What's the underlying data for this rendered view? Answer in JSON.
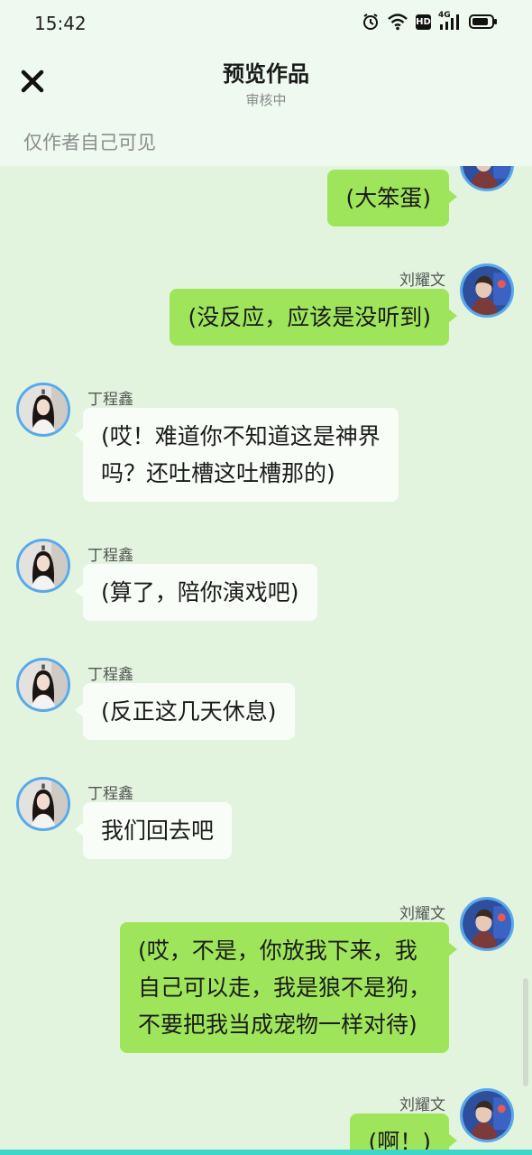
{
  "status_bar": {
    "time": "15:42",
    "network_label": "4G",
    "hd_label": "HD",
    "icons": [
      "alarm-icon",
      "wifi-icon",
      "hd-icon",
      "signal-icon",
      "battery-icon"
    ]
  },
  "header": {
    "title": "预览作品",
    "subtitle": "审核中",
    "visibility_note": "仅作者自己可见",
    "close_icon": "close-icon"
  },
  "colors": {
    "background": "#e2f4de",
    "header_background": "#eef9f0",
    "self_bubble": "#9fe55b",
    "other_bubble": "#f9fdf8",
    "avatar_ring": "#57a9ec",
    "bottom_accent": "#3dd6c9"
  },
  "messages": [
    {
      "side": "right",
      "sender": "",
      "text": "(大笨蛋)"
    },
    {
      "side": "right",
      "sender": "刘耀文",
      "text": "(没反应，应该是没听到)"
    },
    {
      "side": "left",
      "sender": "丁程鑫",
      "text": "(哎！难道你不知道这是神界\n吗？还吐槽这吐槽那的)"
    },
    {
      "side": "left",
      "sender": "丁程鑫",
      "text": "(算了，陪你演戏吧)"
    },
    {
      "side": "left",
      "sender": "丁程鑫",
      "text": "(反正这几天休息)"
    },
    {
      "side": "left",
      "sender": "丁程鑫",
      "text": "我们回去吧"
    },
    {
      "side": "right",
      "sender": "刘耀文",
      "text": "(哎，不是，你放我下来，我\n自己可以走，我是狼不是狗，\n不要把我当成宠物一样对待)"
    },
    {
      "side": "right",
      "sender": "刘耀文",
      "text": "(啊！)"
    }
  ]
}
